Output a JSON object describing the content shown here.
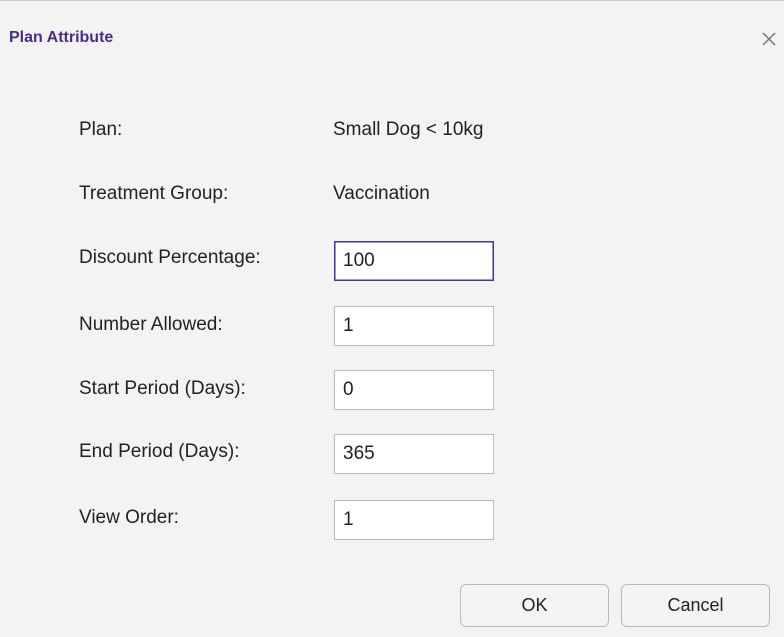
{
  "dialog": {
    "title": "Plan Attribute",
    "close_icon": "close-icon"
  },
  "info": {
    "plan_label": "Plan:",
    "plan_value": "Small Dog < 10kg",
    "treatment_label": "Treatment Group:",
    "treatment_value": "Vaccination"
  },
  "fields": {
    "discount_label": "Discount Percentage:",
    "discount_value": "100",
    "number_allowed_label": "Number Allowed:",
    "number_allowed_value": "1",
    "start_period_label": "Start Period (Days):",
    "start_period_value": "0",
    "end_period_label": "End Period (Days):",
    "end_period_value": "365",
    "view_order_label": "View Order:",
    "view_order_value": "1"
  },
  "buttons": {
    "ok_label": "OK",
    "cancel_label": "Cancel"
  },
  "colors": {
    "title": "#4a2b8a",
    "focus_border": "#3a3a9a",
    "background": "#f3f3f3"
  }
}
